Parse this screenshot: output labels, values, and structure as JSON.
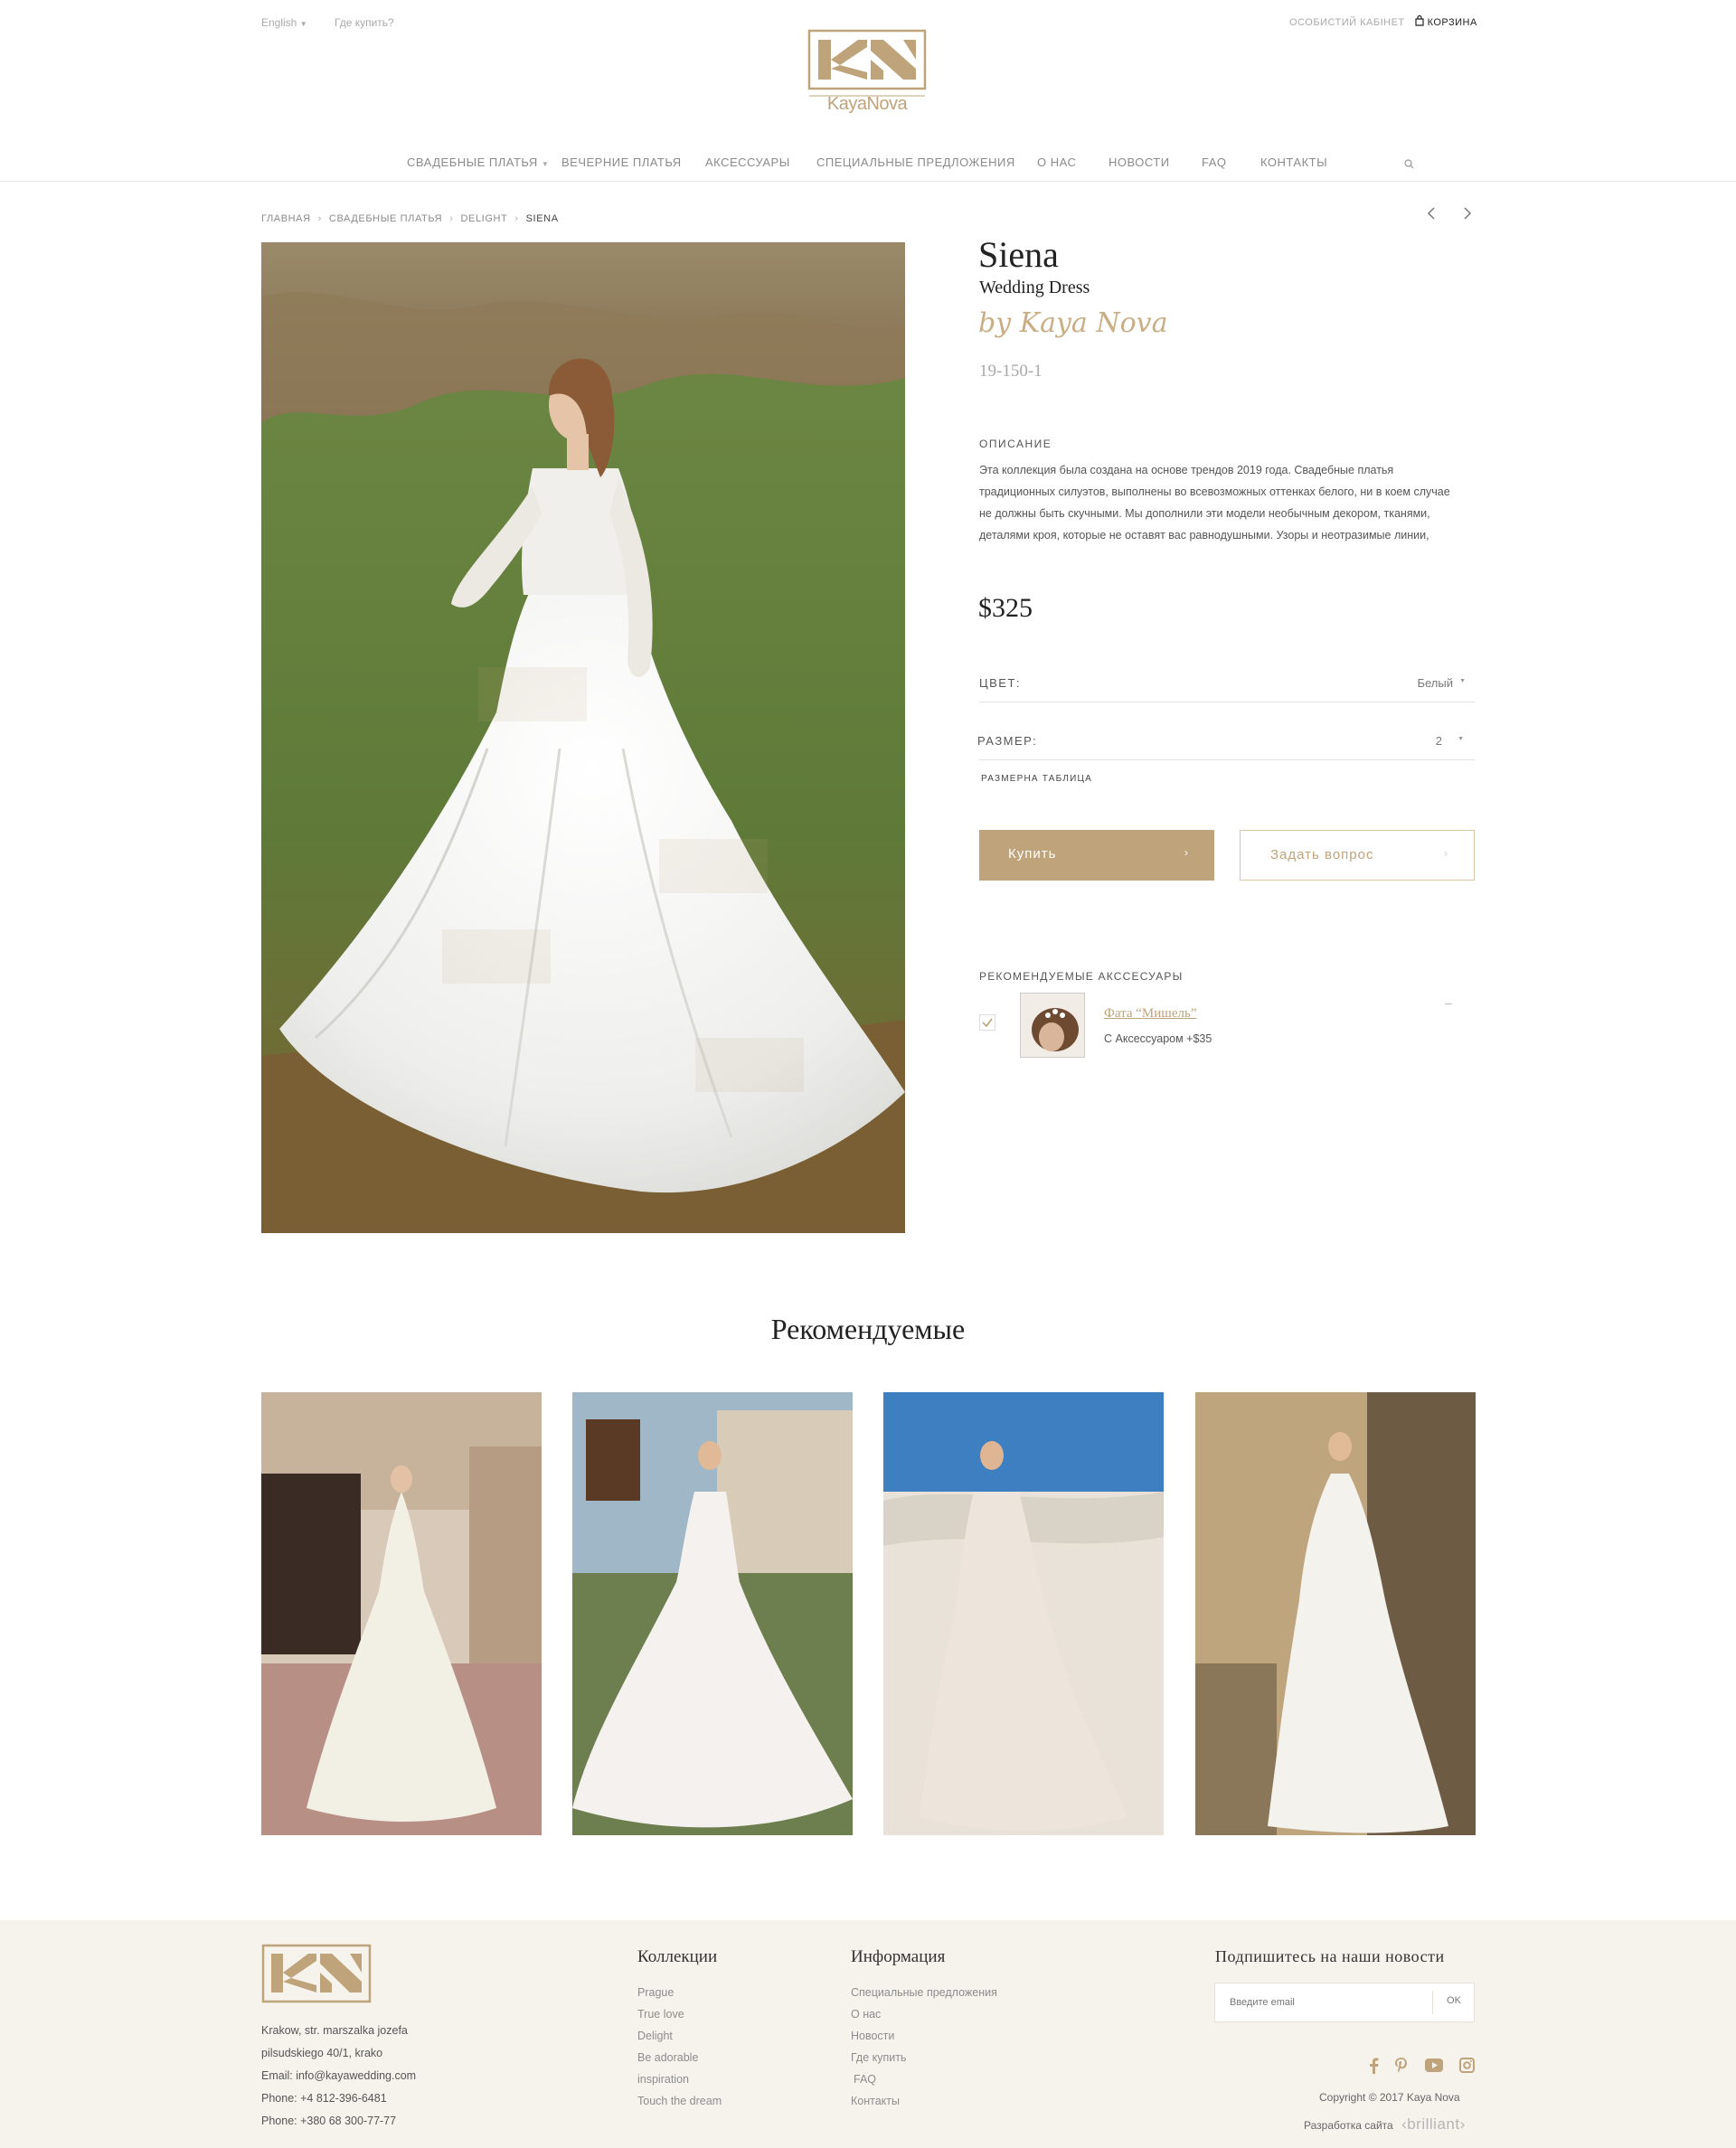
{
  "header": {
    "language": "English",
    "where_to_buy": "Где купить?",
    "account": "ОСОБИСТИЙ КАБІНЕТ",
    "cart": "КОРЗИНА",
    "logo_text": "KayaNova"
  },
  "nav": [
    {
      "label": "СВАДЕБНЫЕ ПЛАТЬЯ"
    },
    {
      "label": "ВЕЧЕРНИЕ ПЛАТЬЯ"
    },
    {
      "label": "АКСЕССУАРЫ"
    },
    {
      "label": "СПЕЦИАЛЬНЫЕ ПРЕДЛОЖЕНИЯ"
    },
    {
      "label": "О НАС"
    },
    {
      "label": "НОВОСТИ"
    },
    {
      "label": "FAQ"
    },
    {
      "label": "КОНТАКТЫ"
    }
  ],
  "breadcrumb": [
    "ГЛАВНАЯ",
    "СВАДЕБНЫЕ ПЛАТЬЯ",
    "DELIGHT",
    "SIENA"
  ],
  "product": {
    "name": "Siena",
    "type": "Wedding Dress",
    "byline": "by Kaya Nova",
    "sku": "19-150-1",
    "description_title": "ОПИСАНИЕ",
    "description": [
      "Эта коллекция была создана на основе трендов 2019 года. Свадебные платья",
      "традиционных силуэтов, выполнены во всевозможных оттенках белого, ни в коем случае",
      "не должны быть скучными. Мы дополнили эти модели необычным декором, тканями,",
      "деталями кроя, которые не оставят вас равнодушными. Узоры и неотразимые линии,"
    ],
    "price": "$325",
    "color_label": "ЦВЕТ:",
    "color_value": "Белый",
    "size_label": "РАЗМЕР:",
    "size_value": "2",
    "size_table": "РАЗМЕРНА ТАБЛИЦА",
    "buy_label": "Купить",
    "ask_label": "Задать вопрос",
    "accessories_title": "РЕКОМЕНДУЕМЫЕ АКССЕСУАРЫ",
    "accessory_name": "Фата “Мишель”",
    "accessory_price": "С Аксессуаром +$35"
  },
  "recommended_title": "Рекомендуемые",
  "footer": {
    "address": [
      "Krakow, str. marszalka jozefa",
      "pilsudskiego 40/1, krako",
      "Email: info@kayawedding.com",
      "Phone: +4 812-396-6481",
      "Phone: +380 68 300-77-77"
    ],
    "collections_title": "Коллекции",
    "collections": [
      "Prague",
      "True love",
      "Delight",
      "Be adorable",
      "inspiration",
      "Touch the dream"
    ],
    "info_title": "Информация",
    "info": [
      "Специальные предложения",
      "О нас",
      "Новости",
      "Где купить",
      "FAQ",
      "Контакты"
    ],
    "subscribe_title": "Подпишитесь на наши новости",
    "email_placeholder": "Введите email",
    "ok_label": "OK",
    "copyright": "Copyright © 2017 Kaya Nova",
    "developer_label": "Разработка сайта",
    "developer_name": "‹brilliant›"
  },
  "colors": {
    "accent": "#bfa37a",
    "footer_bg": "#f6f3ed"
  }
}
